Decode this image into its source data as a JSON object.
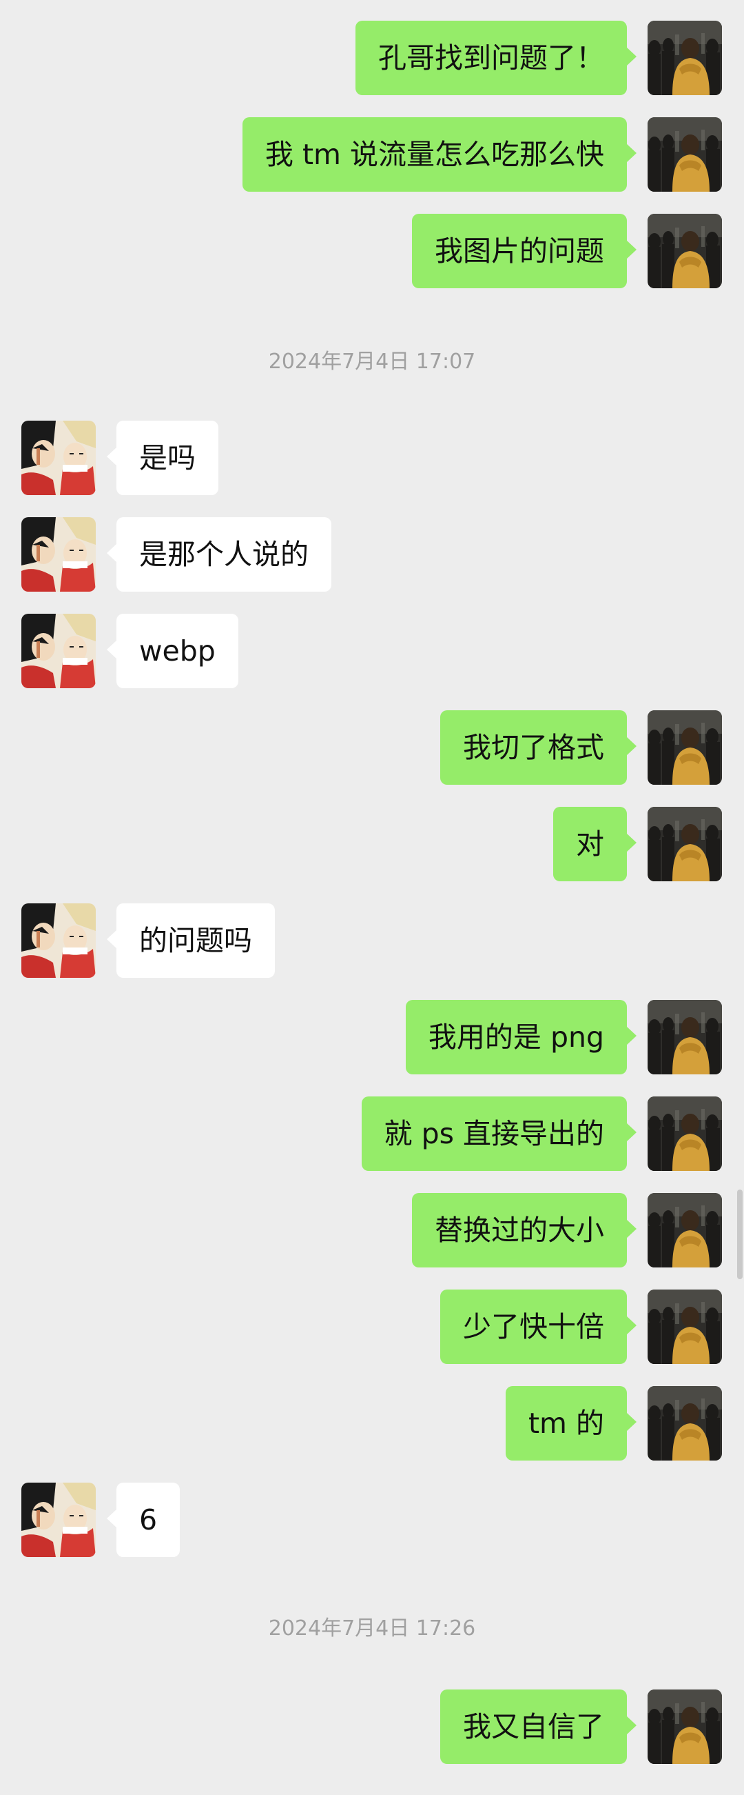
{
  "colors": {
    "background": "#ededed",
    "outgoing_bubble": "#95ec69",
    "incoming_bubble": "#ffffff",
    "timestamp_text": "#a0a0a0"
  },
  "messages": [
    {
      "side": "out",
      "text": "孔哥找到问题了！"
    },
    {
      "side": "out",
      "text": "我 tm 说流量怎么吃那么快"
    },
    {
      "side": "out",
      "text": "我图片的问题"
    },
    {
      "type": "time",
      "text": "2024年7月4日 17:07"
    },
    {
      "side": "in",
      "text": "是吗"
    },
    {
      "side": "in",
      "text": "是那个人说的"
    },
    {
      "side": "in",
      "text": "webp"
    },
    {
      "side": "out",
      "text": "我切了格式"
    },
    {
      "side": "out",
      "text": "对"
    },
    {
      "side": "in",
      "text": "的问题吗"
    },
    {
      "side": "out",
      "text": "我用的是 png"
    },
    {
      "side": "out",
      "text": "就 ps 直接导出的"
    },
    {
      "side": "out",
      "text": "替换过的大小"
    },
    {
      "side": "out",
      "text": "少了快十倍"
    },
    {
      "side": "out",
      "text": "tm 的"
    },
    {
      "side": "in",
      "text": "6"
    },
    {
      "type": "time",
      "text": "2024年7月4日 17:26"
    },
    {
      "side": "out",
      "text": "我又自信了"
    }
  ],
  "icons": {
    "self_avatar": "avatar-self-icon",
    "contact_avatar": "avatar-contact-icon"
  }
}
